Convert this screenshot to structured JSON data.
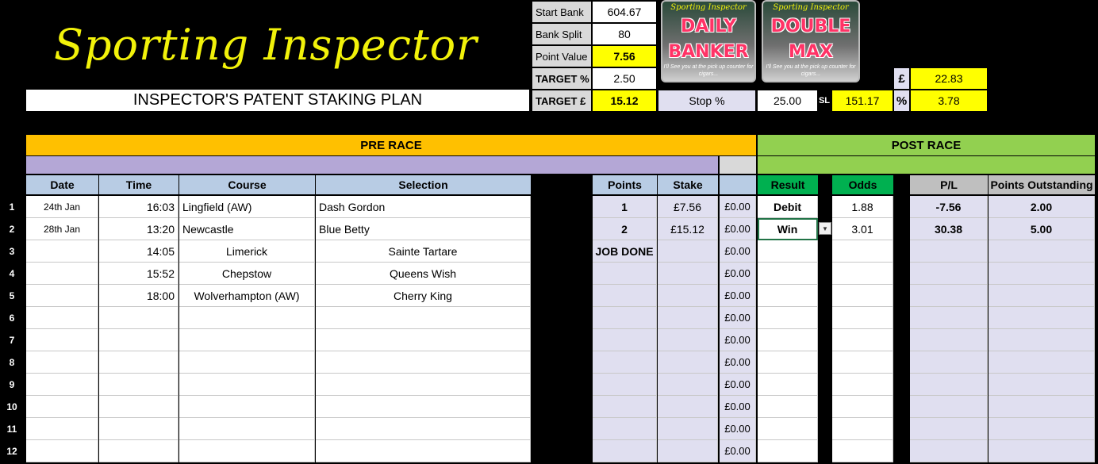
{
  "header": {
    "logo_text": "Sporting Inspector",
    "subtitle": "INSPECTOR'S PATENT STAKING PLAN"
  },
  "settings": {
    "start_bank_label": "Start Bank",
    "start_bank": "604.67",
    "bank_split_label": "Bank Split",
    "bank_split": "80",
    "point_value_label": "Point Value",
    "point_value": "7.56",
    "target_pct_label": "TARGET %",
    "target_pct": "2.50",
    "target_gbp_label": "TARGET £",
    "target_gbp": "15.12",
    "stop_pct_label": "Stop %",
    "stop_pct": "25.00",
    "sl_label": "SL",
    "sl_value": "151.17",
    "pound_symbol": "£",
    "pound_value": "22.83",
    "pct_symbol": "%",
    "pct_value": "3.78"
  },
  "promos": [
    {
      "brand": "Sporting Inspector",
      "line1": "DAILY",
      "line2": "BANKER",
      "tagline": "I'll See you at the pick up counter for cigars..."
    },
    {
      "brand": "Sporting Inspector",
      "line1": "DOUBLE",
      "line2": "MAX",
      "tagline": "I'll See you at the pick up counter for cigars..."
    }
  ],
  "bands": {
    "pre_race": "PRE RACE",
    "post_race": "POST RACE"
  },
  "columns": {
    "date": "Date",
    "time": "Time",
    "course": "Course",
    "selection": "Selection",
    "points": "Points",
    "stake": "Stake",
    "result": "Result",
    "odds": "Odds",
    "pl": "P/L",
    "points_outstanding": "Points Outstanding"
  },
  "rows": [
    {
      "num": "1",
      "date": "24th Jan",
      "time": "16:03",
      "course": "Lingfield (AW)",
      "selection": "Dash Gordon",
      "points": "1",
      "stake": "£7.56",
      "amount": "£0.00",
      "result": "Debit",
      "odds": "1.88",
      "pl": "-7.56",
      "outstanding": "2.00"
    },
    {
      "num": "2",
      "date": "28th Jan",
      "time": "13:20",
      "course": "Newcastle",
      "selection": "Blue Betty",
      "points": "2",
      "stake": "£15.12",
      "amount": "£0.00",
      "result": "Win",
      "odds": "3.01",
      "pl": "30.38",
      "outstanding": "5.00"
    },
    {
      "num": "3",
      "date": "",
      "time": "14:05",
      "course": "Limerick",
      "selection": "Sainte Tartare",
      "points": "JOB DONE",
      "stake": "",
      "amount": "£0.00",
      "result": "",
      "odds": "",
      "pl": "",
      "outstanding": ""
    },
    {
      "num": "4",
      "date": "",
      "time": "15:52",
      "course": "Chepstow",
      "selection": "Queens Wish",
      "points": "",
      "stake": "",
      "amount": "£0.00",
      "result": "",
      "odds": "",
      "pl": "",
      "outstanding": ""
    },
    {
      "num": "5",
      "date": "",
      "time": "18:00",
      "course": "Wolverhampton (AW)",
      "selection": "Cherry King",
      "points": "",
      "stake": "",
      "amount": "£0.00",
      "result": "",
      "odds": "",
      "pl": "",
      "outstanding": ""
    },
    {
      "num": "6",
      "date": "",
      "time": "",
      "course": "",
      "selection": "",
      "points": "",
      "stake": "",
      "amount": "£0.00",
      "result": "",
      "odds": "",
      "pl": "",
      "outstanding": ""
    },
    {
      "num": "7",
      "date": "",
      "time": "",
      "course": "",
      "selection": "",
      "points": "",
      "stake": "",
      "amount": "£0.00",
      "result": "",
      "odds": "",
      "pl": "",
      "outstanding": ""
    },
    {
      "num": "8",
      "date": "",
      "time": "",
      "course": "",
      "selection": "",
      "points": "",
      "stake": "",
      "amount": "£0.00",
      "result": "",
      "odds": "",
      "pl": "",
      "outstanding": ""
    },
    {
      "num": "9",
      "date": "",
      "time": "",
      "course": "",
      "selection": "",
      "points": "",
      "stake": "",
      "amount": "£0.00",
      "result": "",
      "odds": "",
      "pl": "",
      "outstanding": ""
    },
    {
      "num": "10",
      "date": "",
      "time": "",
      "course": "",
      "selection": "",
      "points": "",
      "stake": "",
      "amount": "£0.00",
      "result": "",
      "odds": "",
      "pl": "",
      "outstanding": ""
    },
    {
      "num": "11",
      "date": "",
      "time": "",
      "course": "",
      "selection": "",
      "points": "",
      "stake": "",
      "amount": "£0.00",
      "result": "",
      "odds": "",
      "pl": "",
      "outstanding": ""
    },
    {
      "num": "12",
      "date": "",
      "time": "",
      "course": "",
      "selection": "",
      "points": "",
      "stake": "",
      "amount": "£0.00",
      "result": "",
      "odds": "",
      "pl": "",
      "outstanding": ""
    }
  ],
  "colors": {
    "logo": "#f2f20a",
    "pre_race": "#ffc000",
    "post_race": "#92d050",
    "header_blue": "#b8cce4",
    "header_green": "#00b050",
    "highlight": "#ffff00",
    "lavender": "#e0dff0"
  }
}
